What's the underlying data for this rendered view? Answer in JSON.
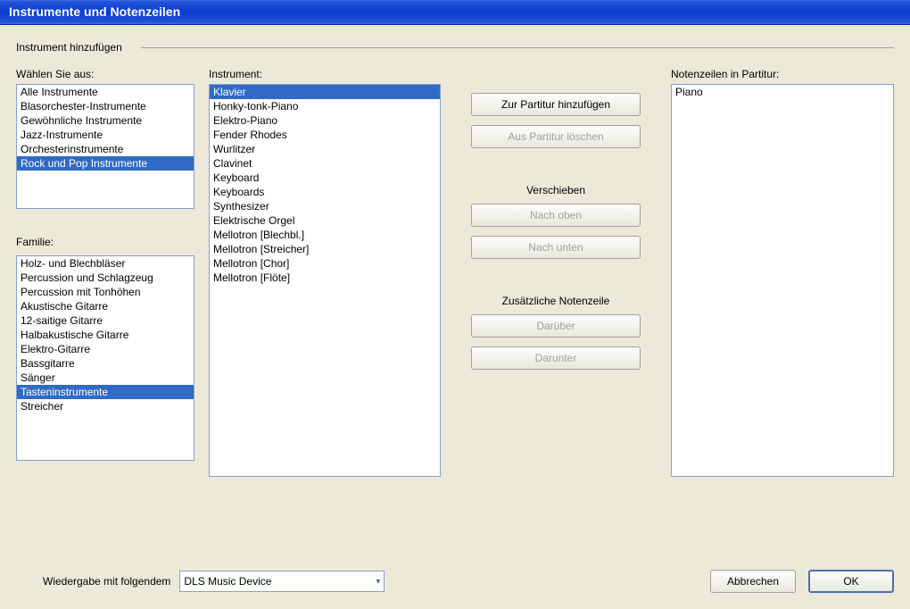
{
  "window": {
    "title": "Instrumente und Notenzeilen"
  },
  "group": {
    "label": "Instrument hinzufügen"
  },
  "choose": {
    "label": "Wählen Sie aus:",
    "items": [
      "Alle Instrumente",
      "Blasorchester-Instrumente",
      "Gewöhnliche Instrumente",
      "Jazz-Instrumente",
      "Orchesterinstrumente",
      "Rock und Pop Instrumente"
    ],
    "selected_index": 5
  },
  "family": {
    "label": "Familie:",
    "items": [
      "Holz- und Blechbläser",
      "Percussion und Schlagzeug",
      "Percussion mit Tonhöhen",
      "Akustische Gitarre",
      "12-saitige Gitarre",
      "Halbakustische Gitarre",
      "Elektro-Gitarre",
      "Bassgitarre",
      "Sänger",
      "Tasteninstrumente",
      "Streicher"
    ],
    "selected_index": 9
  },
  "instrument": {
    "label": "Instrument:",
    "items": [
      "Klavier",
      "Honky-tonk-Piano",
      "Elektro-Piano",
      "Fender Rhodes",
      "Wurlitzer",
      "Clavinet",
      "Keyboard",
      "Keyboards",
      "Synthesizer",
      "Elektrische Orgel",
      "Mellotron [Blechbl.]",
      "Mellotron [Streicher]",
      "Mellotron [Chor]",
      "Mellotron [Flöte]"
    ],
    "selected_index": 0
  },
  "score": {
    "label": "Notenzeilen in Partitur:",
    "items": [
      "Piano"
    ],
    "selected_index": -1
  },
  "buttons": {
    "add": "Zur Partitur hinzufügen",
    "delete": "Aus Partitur löschen",
    "move_label": "Verschieben",
    "move_up": "Nach oben",
    "move_down": "Nach unten",
    "extra_label": "Zusätzliche Notenzeile",
    "above": "Darüber",
    "below": "Darunter"
  },
  "playback": {
    "label": "Wiedergabe mit folgendem",
    "value": "DLS Music Device"
  },
  "dialog": {
    "cancel": "Abbrechen",
    "ok": "OK"
  }
}
